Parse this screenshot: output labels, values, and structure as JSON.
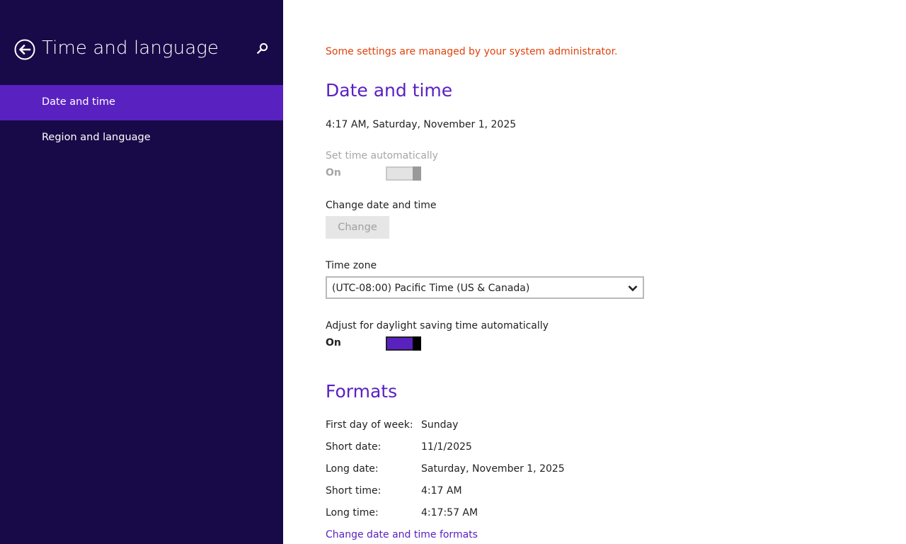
{
  "sidebar": {
    "title": "Time and language",
    "back_icon": "back-arrow-circle-icon",
    "search_icon": "search-icon",
    "items": [
      {
        "label": "Date and time",
        "active": true
      },
      {
        "label": "Region and language",
        "active": false
      }
    ]
  },
  "main": {
    "admin_note": "Some settings are managed by your system administrator.",
    "date_time": {
      "heading": "Date and time",
      "current": "4:17 AM, Saturday, November 1, 2025",
      "set_auto": {
        "label": "Set time automatically",
        "state": "On",
        "enabled": false
      },
      "change": {
        "label": "Change date and time",
        "button": "Change"
      },
      "time_zone": {
        "label": "Time zone",
        "value": "(UTC-08:00) Pacific Time (US & Canada)"
      },
      "dst": {
        "label": "Adjust for daylight saving time automatically",
        "state": "On",
        "enabled": true
      }
    },
    "formats": {
      "heading": "Formats",
      "rows": [
        {
          "label": "First day of week:",
          "value": "Sunday"
        },
        {
          "label": "Short date:",
          "value": "11/1/2025"
        },
        {
          "label": "Long date:",
          "value": "Saturday, November 1, 2025"
        },
        {
          "label": "Short time:",
          "value": "4:17 AM"
        },
        {
          "label": "Long time:",
          "value": "4:17:57 AM"
        }
      ],
      "link": "Change date and time formats"
    }
  },
  "colors": {
    "sidebar_bg": "#180a48",
    "accent": "#5a21c1",
    "warning": "#e0420c"
  }
}
